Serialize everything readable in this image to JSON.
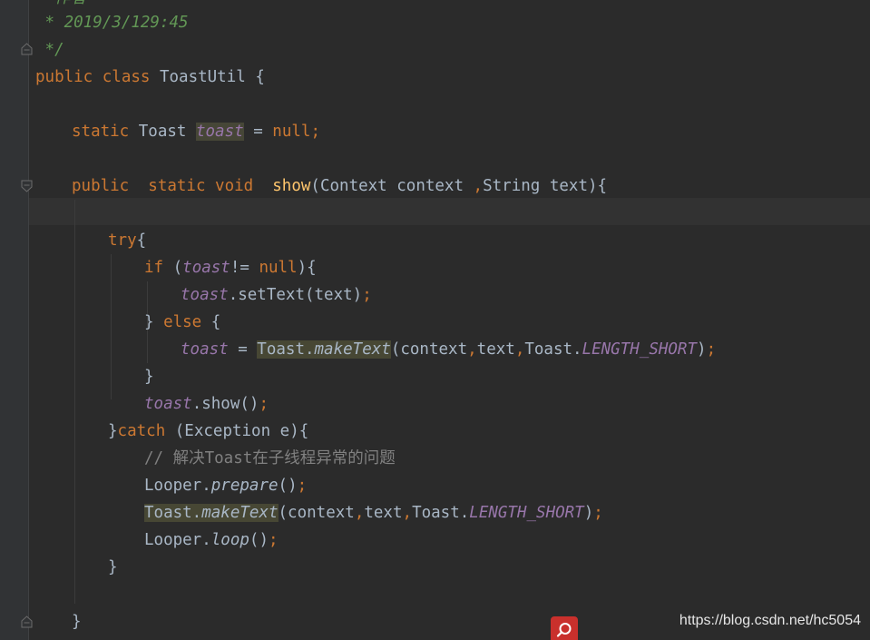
{
  "editor": {
    "lines": {
      "l0": "  作者",
      "l1": " * 2019/3/129:45",
      "l2": " */",
      "l3": {
        "a": "public class ",
        "b": "ToastUtil {"
      },
      "l4": {
        "a": "static ",
        "b": "Toast ",
        "c": "toast",
        "d": " = ",
        "e": "null",
        "f": ";"
      },
      "l5": {
        "a": "public  static void  ",
        "b": "show",
        "c": "(Context context ",
        "d": ",",
        "e": "String text){"
      },
      "l6": {
        "a": "try",
        "b": "{"
      },
      "l7": {
        "a": "if ",
        "b": "(",
        "c": "toast",
        "d": "!= ",
        "e": "null",
        "f": "){"
      },
      "l8": {
        "a": "toast",
        "b": ".setText(text)",
        "c": ";"
      },
      "l9": {
        "a": "} ",
        "b": "else ",
        "c": "{"
      },
      "l10": {
        "a": "toast",
        "b": " = ",
        "c": "Toast.",
        "d": "makeText",
        "e": "(context",
        "f": ",",
        "g": "text",
        "h": ",",
        "i": "Toast.",
        "j": "LENGTH_SHORT",
        "k": ")",
        "l": ";"
      },
      "l11": "}",
      "l12": {
        "a": "toast",
        "b": ".show()",
        "c": ";"
      },
      "l13": {
        "a": "}",
        "b": "catch ",
        "c": "(Exception e){"
      },
      "l14": "// 解决Toast在子线程异常的问题",
      "l15": {
        "a": "Looper.",
        "b": "prepare",
        "c": "()",
        "d": ";"
      },
      "l16": {
        "a": "Toast.",
        "b": "makeText",
        "c": "(context",
        "d": ",",
        "e": "text",
        "f": ",",
        "g": "Toast.",
        "h": "LENGTH_SHORT",
        "i": ")",
        "j": ";"
      },
      "l17": {
        "a": "Looper.",
        "b": "loop",
        "c": "()",
        "d": ";"
      },
      "l18": "}",
      "l19": "}"
    }
  },
  "watermark": "https://blog.csdn.net/hc5054",
  "colors": {
    "background": "#2b2b2b",
    "keyword": "#cc7832",
    "doc_comment": "#629755",
    "line_comment": "#808080",
    "field": "#9876aa",
    "method_decl": "#ffc66d",
    "text": "#a9b7c6",
    "search_button": "#c9302c"
  },
  "icons": [
    "fold-marker-icon",
    "search-icon"
  ]
}
